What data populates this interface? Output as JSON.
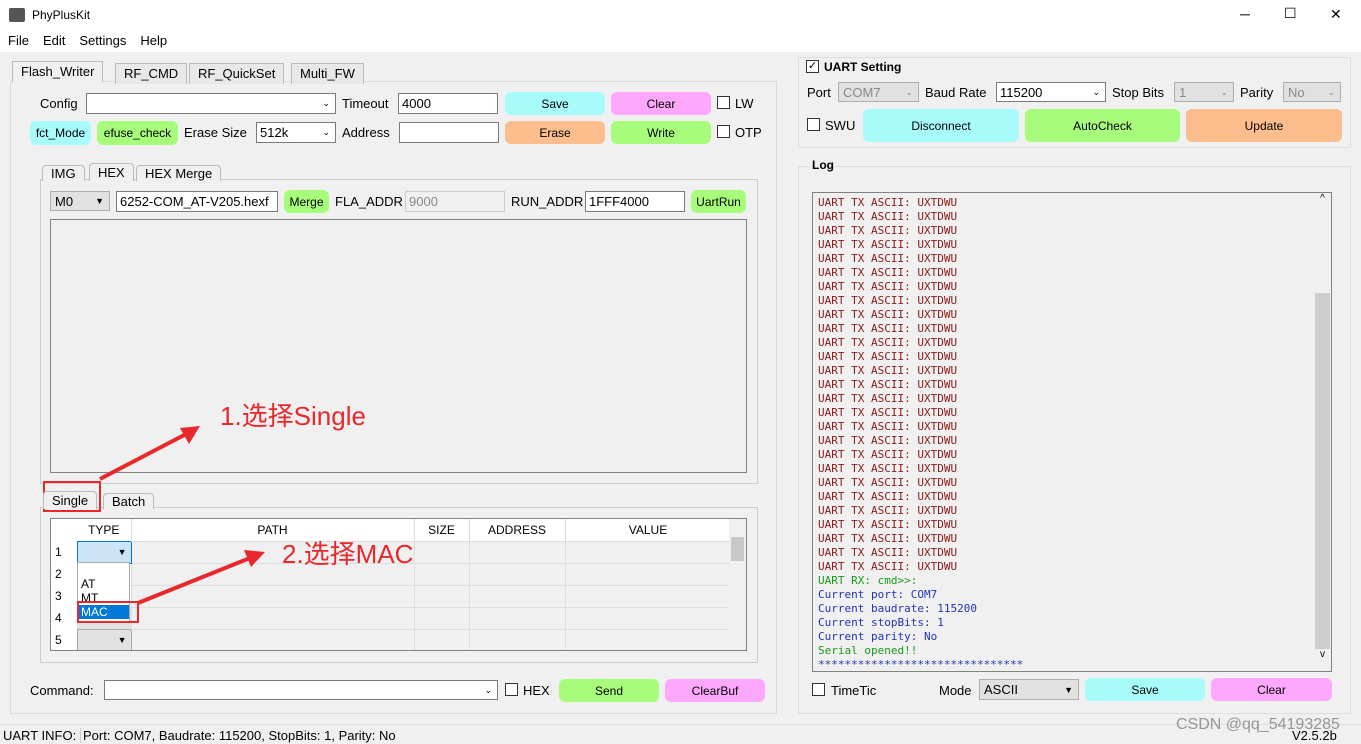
{
  "window": {
    "title": "PhyPlusKit",
    "min": "─",
    "max": "☐",
    "close": "✕"
  },
  "menu": [
    "File",
    "Edit",
    "Settings",
    "Help"
  ],
  "tabs": [
    "Flash_Writer",
    "RF_CMD",
    "RF_QuickSet",
    "Multi_FW"
  ],
  "flash": {
    "config_label": "Config",
    "config_value": "",
    "timeout_label": "Timeout",
    "timeout_value": "4000",
    "save": "Save",
    "clear": "Clear",
    "lw": "LW",
    "fct_mode": "fct_Mode",
    "efuse_check": "efuse_check",
    "erase_size_label": "Erase Size",
    "erase_size_value": "512k",
    "address_label": "Address",
    "address_value": "",
    "erase": "Erase",
    "write": "Write",
    "otp": "OTP"
  },
  "subtabs": [
    "IMG",
    "HEX",
    "HEX Merge"
  ],
  "hex": {
    "mode": "M0",
    "file": "6252-COM_AT-V205.hexf",
    "merge": "Merge",
    "fla_addr_label": "FLA_ADDR",
    "fla_addr_value": "9000",
    "run_addr_label": "RUN_ADDR",
    "run_addr_value": "1FFF4000",
    "uartrun": "UartRun"
  },
  "single_tabs": [
    "Single",
    "Batch"
  ],
  "table": {
    "columns": [
      "TYPE",
      "PATH",
      "SIZE",
      "ADDRESS",
      "VALUE"
    ],
    "rows": [
      "1",
      "2",
      "3",
      "4",
      "5"
    ],
    "dropdown_options": [
      "AT",
      "MT",
      "MAC"
    ],
    "selected_option": "MAC"
  },
  "annotations": [
    "1.选择Single",
    "2.选择MAC"
  ],
  "command": {
    "label": "Command:",
    "value": "",
    "hex": "HEX",
    "send": "Send",
    "clearbuf": "ClearBuf"
  },
  "status": {
    "label": "UART INFO:",
    "text": "Port: COM7, Baudrate: 115200, StopBits: 1, Parity: No",
    "version": "V2.5.2b"
  },
  "watermark": "CSDN @qq_54193285",
  "uart": {
    "title": "UART Setting",
    "checked": true,
    "port_label": "Port",
    "port_value": "COM7",
    "baud_label": "Baud Rate",
    "baud_value": "115200",
    "stop_label": "Stop Bits",
    "stop_value": "1",
    "parity_label": "Parity",
    "parity_value": "No",
    "swu": "SWU",
    "disconnect": "Disconnect",
    "autocheck": "AutoCheck",
    "update": "Update"
  },
  "log": {
    "title": "Log",
    "tx_line": "UART TX ASCII: UXTDWU",
    "tx_count": 27,
    "rx": "UART RX: cmd>>:",
    "info": [
      "Current port: COM7",
      "Current baudrate: 115200",
      "Current stopBits: 1",
      "Current parity: No"
    ],
    "opened": "Serial opened!!",
    "stars": "*******************************",
    "timetic": "TimeTic",
    "mode_label": "Mode",
    "mode_value": "ASCII",
    "save": "Save",
    "clear": "Clear"
  },
  "colors": {
    "cyan": "#a8fbfb",
    "pink": "#fda8fd",
    "green": "#a8fc7c",
    "orange": "#fdbd8c",
    "annotation": "#e8282c"
  }
}
